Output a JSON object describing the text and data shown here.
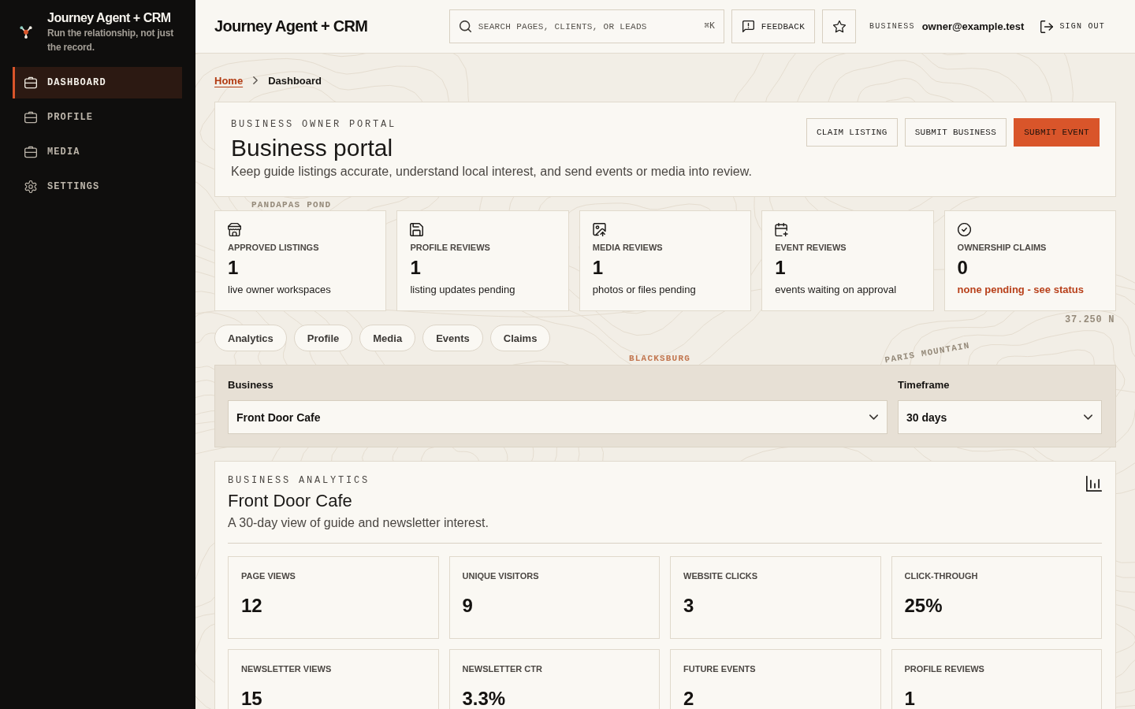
{
  "sidebar": {
    "brand": {
      "title": "Journey Agent + CRM",
      "tagline": "Run the relationship, not just the record."
    },
    "items": [
      {
        "label": "DASHBOARD",
        "kind": "page",
        "selected": true
      },
      {
        "label": "PROFILE",
        "kind": "page",
        "selected": false
      },
      {
        "label": "MEDIA",
        "kind": "page",
        "selected": false
      },
      {
        "label": "SETTINGS",
        "kind": "settings",
        "selected": false
      }
    ]
  },
  "header": {
    "title": "Journey Agent + CRM",
    "search": {
      "placeholder": "SEARCH PAGES, CLIENTS, OR LEADS",
      "shortcut": "⌘K"
    },
    "feedback_button": "FEEDBACK",
    "account": {
      "role": "BUSINESS",
      "email": "owner@example.test"
    },
    "sign_out_button": "SIGN OUT"
  },
  "breadcrumb": [
    {
      "label": "Home",
      "kind": "link"
    },
    {
      "label": "Dashboard",
      "kind": "current"
    }
  ],
  "portal": {
    "eyebrow": "BUSINESS OWNER PORTAL",
    "title": "Business portal",
    "description": "Keep guide listings accurate, understand local interest, and send events or media into review.",
    "actions": [
      {
        "label": "CLAIM LISTING",
        "primary": false
      },
      {
        "label": "SUBMIT BUSINESS",
        "primary": false
      },
      {
        "label": "SUBMIT EVENT",
        "primary": true
      }
    ]
  },
  "stats": [
    {
      "label": "APPROVED LISTINGS",
      "value": "1",
      "note": "live owner workspaces",
      "kind": "plain"
    },
    {
      "label": "PROFILE REVIEWS",
      "value": "1",
      "note": "listing updates pending",
      "kind": "plain"
    },
    {
      "label": "MEDIA REVIEWS",
      "value": "1",
      "note": "photos or files pending",
      "kind": "plain"
    },
    {
      "label": "EVENT REVIEWS",
      "value": "1",
      "note": "events waiting on approval",
      "kind": "plain"
    },
    {
      "label": "OWNERSHIP CLAIMS",
      "value": "0",
      "note": "none pending - see status",
      "kind": "alert"
    }
  ],
  "section_links": [
    "Analytics",
    "Profile",
    "Media",
    "Events",
    "Claims"
  ],
  "filters": [
    {
      "label": "Business",
      "value": "Front Door Cafe"
    },
    {
      "label": "Timeframe",
      "value": "30 days"
    }
  ],
  "analytics": {
    "eyebrow": "BUSINESS ANALYTICS",
    "title": "Front Door Cafe",
    "description": "A 30-day view of guide and newsletter interest.",
    "metrics": [
      {
        "label": "PAGE VIEWS",
        "value": "12"
      },
      {
        "label": "UNIQUE VISITORS",
        "value": "9"
      },
      {
        "label": "WEBSITE CLICKS",
        "value": "3"
      },
      {
        "label": "CLICK-THROUGH",
        "value": "25%"
      },
      {
        "label": "NEWSLETTER VIEWS",
        "value": "15"
      },
      {
        "label": "NEWSLETTER CTR",
        "value": "3.3%"
      },
      {
        "label": "FUTURE EVENTS",
        "value": "2"
      },
      {
        "label": "PROFILE REVIEWS",
        "value": "1"
      }
    ]
  },
  "map_labels": [
    {
      "text": "PANDAPAS POND",
      "kind": "water"
    },
    {
      "text": "37.250 N",
      "kind": "coordinate"
    },
    {
      "text": "BLACKSBURG",
      "kind": "town"
    },
    {
      "text": "PARIS MOUNTAIN",
      "kind": "ridge"
    }
  ]
}
